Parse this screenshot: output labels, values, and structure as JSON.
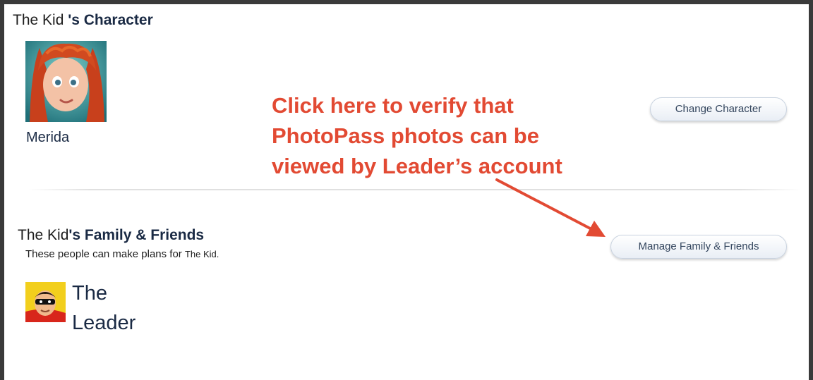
{
  "character_section": {
    "heading_prefix": "The Kid ",
    "heading_suffix": "'s Character",
    "character_name": "Merida",
    "change_button_label": "Change Character"
  },
  "annotation": {
    "lines": [
      "Click here to verify that",
      "PhotoPass photos can be",
      "viewed by Leader’s account"
    ],
    "color": "#e24a33"
  },
  "family_section": {
    "heading_prefix": "The Kid",
    "heading_suffix": "'s Family & Friends",
    "subtext_prefix": "These people can make plans for ",
    "subtext_name": "The Kid.",
    "manage_button_label": "Manage Family & Friends",
    "members": [
      {
        "name_line1": "The",
        "name_line2": "Leader",
        "avatar_icon": "incredibles-avatar-icon"
      }
    ]
  },
  "icons": {
    "character_avatar": "merida-avatar-icon"
  }
}
